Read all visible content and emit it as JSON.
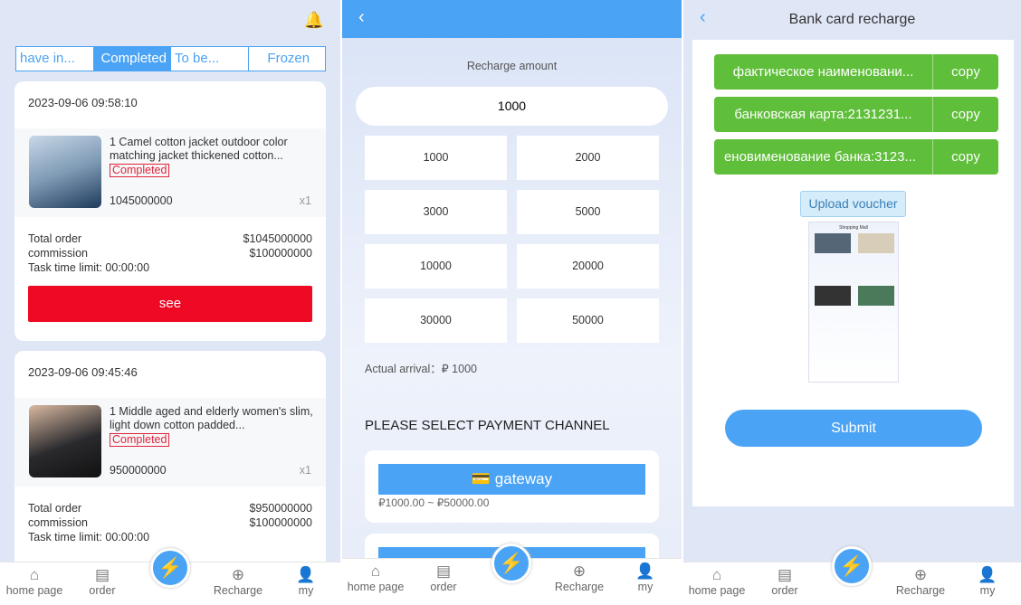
{
  "nav": {
    "home": "home page",
    "order": "order",
    "recharge": "Recharge",
    "my": "my"
  },
  "orders": {
    "tabs": [
      "have in...",
      "Completed",
      "To be...",
      "Frozen"
    ],
    "active_tab": 1,
    "items": [
      {
        "date": "2023-09-06 09:58:10",
        "name": "1 Camel cotton jacket outdoor color matching jacket thickened cotton...",
        "status": "Completed",
        "price": "1045000000",
        "qty": "x1",
        "total_label": "Total order",
        "total": "$1045000000",
        "commission_label": "commission",
        "commission": "$100000000",
        "limit": "Task time limit: 00:00:00",
        "see": "see"
      },
      {
        "date": "2023-09-06 09:45:46",
        "name": "1 Middle aged and elderly women's slim, light down cotton padded...",
        "status": "Completed",
        "price": "950000000",
        "qty": "x1",
        "total_label": "Total order",
        "total": "$950000000",
        "commission_label": "commission",
        "commission": "$100000000",
        "limit": "Task time limit: 00:00:00"
      }
    ]
  },
  "recharge": {
    "label": "Recharge amount",
    "amount": "1000",
    "options": [
      "1000",
      "2000",
      "3000",
      "5000",
      "10000",
      "20000",
      "30000",
      "50000"
    ],
    "arrival": "Actual arrival：₽ 1000",
    "channel_heading": "PLEASE SELECT PAYMENT CHANNEL",
    "channel": "gateway",
    "range": "₽1000.00 ~ ₽50000.00"
  },
  "bank": {
    "title": "Bank card recharge",
    "rows": [
      {
        "text": "фактическое наименовани...",
        "copy": "copy"
      },
      {
        "text": "банковская карта:2131231...",
        "copy": "copy"
      },
      {
        "text": "еновимeнование банка:3123...",
        "copy": "copy"
      }
    ],
    "upload": "Upload voucher",
    "voucher_caption": "Shopping Mall",
    "submit": "Submit"
  },
  "colors": {
    "primary": "#4aa3f5",
    "danger": "#ee0a24",
    "green": "#5fbe3a"
  }
}
